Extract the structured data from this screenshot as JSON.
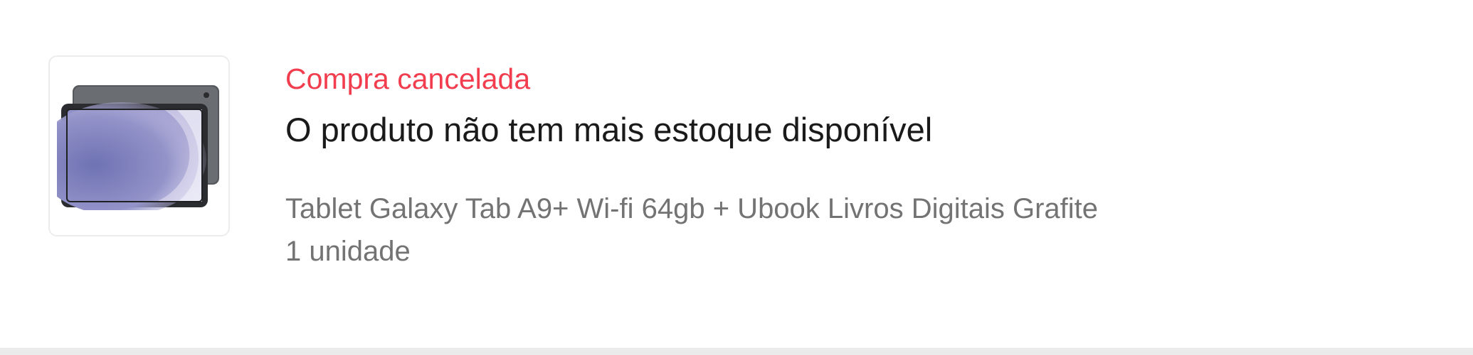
{
  "order": {
    "status": "Compra cancelada",
    "status_color": "#f23d4f",
    "message": "O produto não tem mais estoque disponível",
    "product": {
      "thumbnail_icon": "tablet-image",
      "title": "Tablet Galaxy Tab A9+ Wi-fi 64gb + Ubook Livros Digitais Grafite",
      "quantity": "1 unidade"
    }
  }
}
